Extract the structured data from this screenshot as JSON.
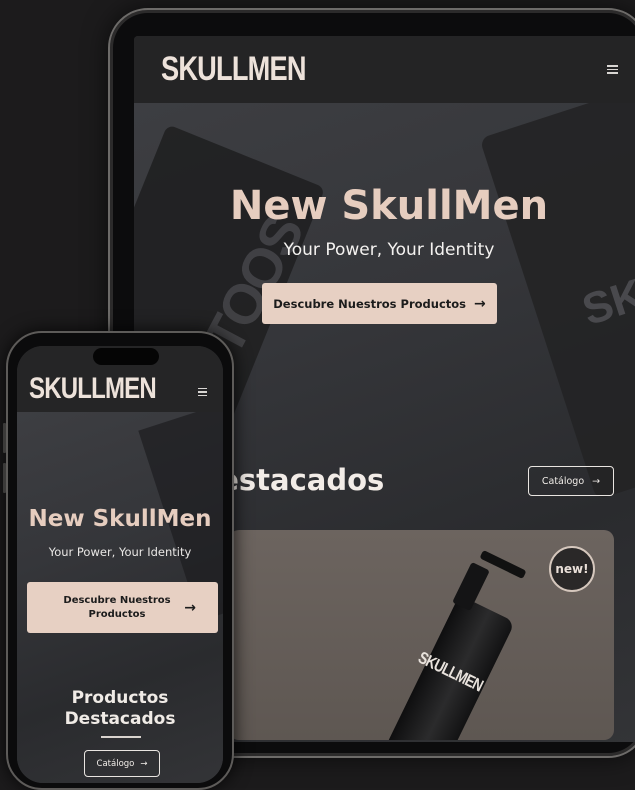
{
  "brand": {
    "logo": "SKULLMEN"
  },
  "hero": {
    "title": "New SkullMen",
    "subtitle": "Your Power, Your Identity",
    "cta_label": "Descubre Nuestros Productos",
    "cta_arrow": "→",
    "bg_text_left": "TOOS",
    "bg_text_right": "SKU"
  },
  "featured": {
    "title_tablet_visible": "tos Destacados",
    "title_phone": "Productos Destacados",
    "catalog_label": "Catálogo",
    "catalog_arrow": "→",
    "badge": "new!",
    "product_label": "SKULLMEN"
  },
  "colors": {
    "accent": "#e7d0c3",
    "hero_title": "#e6cdbf",
    "nav_bg": "#242425",
    "page_bg": "#1c1b1c"
  },
  "icons": {
    "menu": "hamburger-menu-icon",
    "arrow": "arrow-right-icon"
  }
}
